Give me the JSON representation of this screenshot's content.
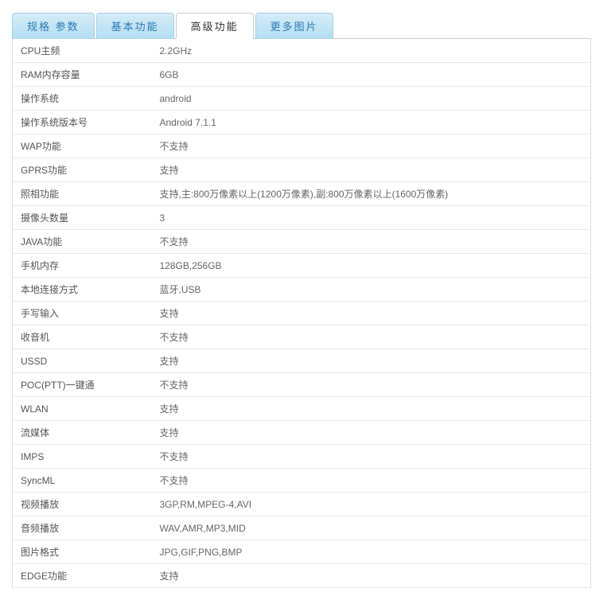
{
  "tabs": [
    {
      "label": "规格 参数",
      "active": false
    },
    {
      "label": "基本功能",
      "active": false
    },
    {
      "label": "高级功能",
      "active": true
    },
    {
      "label": "更多图片",
      "active": false
    }
  ],
  "specs": [
    {
      "label": "CPU主频",
      "value": "2.2GHz"
    },
    {
      "label": "RAM内存容量",
      "value": "6GB"
    },
    {
      "label": "操作系统",
      "value": "android"
    },
    {
      "label": "操作系统版本号",
      "value": "Android 7.1.1"
    },
    {
      "label": "WAP功能",
      "value": "不支持"
    },
    {
      "label": "GPRS功能",
      "value": "支持"
    },
    {
      "label": "照相功能",
      "value": "支持,主:800万像素以上(1200万像素),副:800万像素以上(1600万像素)"
    },
    {
      "label": "摄像头数量",
      "value": "3"
    },
    {
      "label": "JAVA功能",
      "value": "不支持"
    },
    {
      "label": "手机内存",
      "value": "128GB,256GB"
    },
    {
      "label": "本地连接方式",
      "value": "蓝牙,USB"
    },
    {
      "label": "手写输入",
      "value": "支持"
    },
    {
      "label": "收音机",
      "value": "不支持"
    },
    {
      "label": "USSD",
      "value": "支持"
    },
    {
      "label": "POC(PTT)一键通",
      "value": "不支持"
    },
    {
      "label": "WLAN",
      "value": "支持"
    },
    {
      "label": "流媒体",
      "value": "支持"
    },
    {
      "label": "IMPS",
      "value": "不支持"
    },
    {
      "label": "SyncML",
      "value": "不支持"
    },
    {
      "label": "视频播放",
      "value": "3GP,RM,MPEG-4,AVI"
    },
    {
      "label": "音频播放",
      "value": "WAV,AMR,MP3,MID"
    },
    {
      "label": "图片格式",
      "value": "JPG,GIF,PNG,BMP"
    },
    {
      "label": "EDGE功能",
      "value": "支持"
    }
  ]
}
